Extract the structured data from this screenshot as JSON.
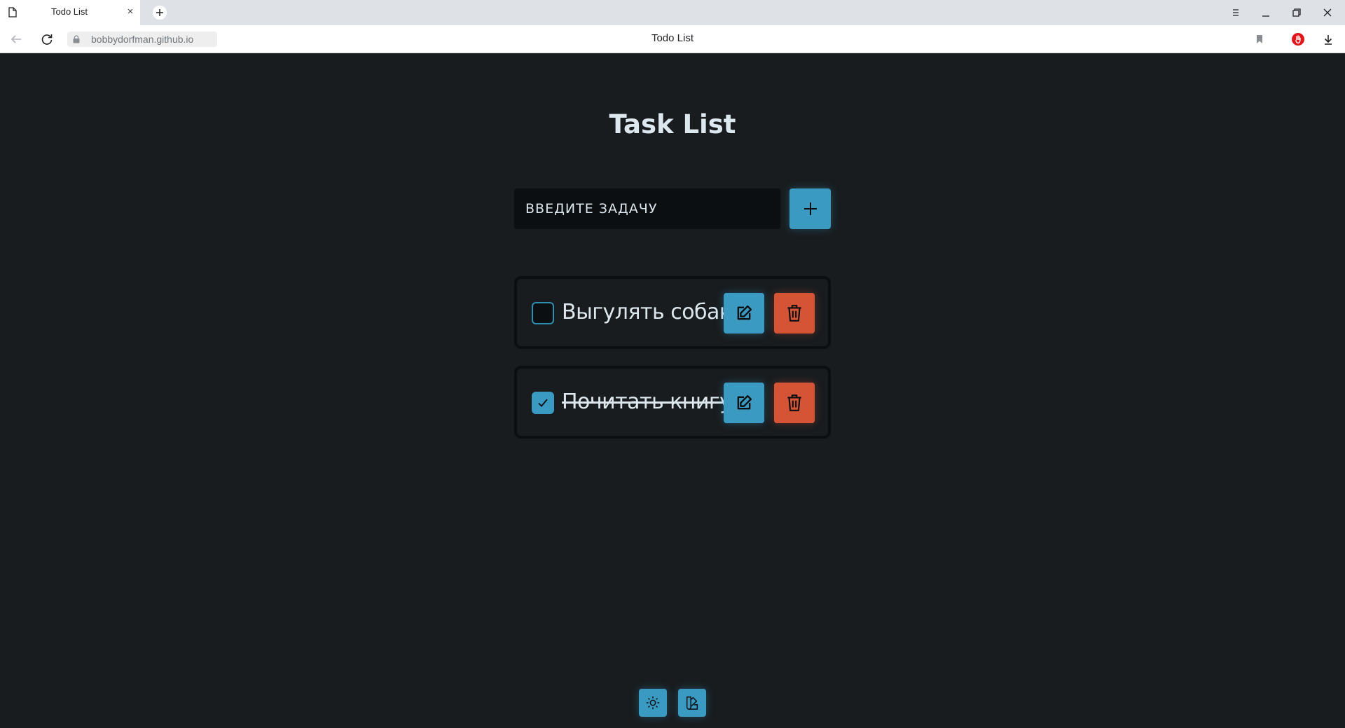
{
  "browser": {
    "tab_title": "Todo List",
    "tab_close": "×",
    "url": "bobbydorfman.github.io",
    "page_title": "Todo List"
  },
  "app": {
    "heading": "Task List",
    "input_placeholder": "ВВЕДИТЕ ЗАДАЧУ",
    "tasks": [
      {
        "text": "Выгулять собаку",
        "done": false
      },
      {
        "text": "Почитать книгу",
        "done": true
      }
    ]
  },
  "colors": {
    "background": "#181c1f",
    "accent": "#3a9ac2",
    "danger": "#d65436",
    "input_bg": "#0c0f11",
    "text": "#dde7ee"
  },
  "icons": {
    "add": "plus-icon",
    "edit": "edit-icon",
    "delete": "trash-icon",
    "theme": "sun-icon",
    "palette": "palette-icon"
  }
}
